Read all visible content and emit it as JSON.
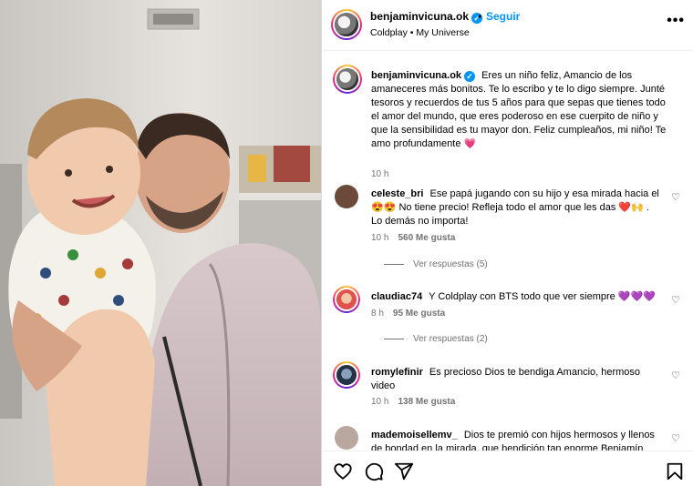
{
  "post": {
    "username": "benjaminvicuna.ok",
    "verified_icon": "verified-badge-icon",
    "follow_label": "Seguir",
    "separator": "•",
    "audio": "Coldplay • My Universe",
    "more_icon": "more-options-icon"
  },
  "caption": {
    "username": "benjaminvicuna.ok",
    "text": "Eres un niño feliz, Amancio de los amaneceres más bonitos. Te lo escribo y te lo digo siempre. Junté tesoros y recuerdos de tus 5 años para que sepas que tienes todo el amor del mundo, que eres poderoso en ese cuerpito de niño y que la sensibilidad es tu mayor don. Feliz cumpleaños, mi niño! Te amo profundamente 💗",
    "time": "10 h"
  },
  "comments": [
    {
      "username": "celeste_bri",
      "text": "Ese papá jugando con su hijo y esa mirada hacia el 😍😍 No tiene precio! Refleja todo el amor que les das ❤️🙌 . Lo demás no importa!",
      "time": "10 h",
      "likes": "560 Me gusta",
      "replies": "Ver respuestas (5)"
    },
    {
      "username": "claudiac74",
      "text": "Y Coldplay con BTS todo que ver siempre 💜💜💜",
      "time": "8 h",
      "likes": "95 Me gusta",
      "replies": "Ver respuestas (2)"
    },
    {
      "username": "romylefinir",
      "text": "Es precioso Dios te bendiga Amancio, hermoso video",
      "time": "10 h",
      "likes": "138 Me gusta"
    },
    {
      "username": "mademoisellemv_",
      "text": "Dios te premió con hijos hermosos y llenos de bondad en la mirada, que bendición tan enorme Benjamín"
    }
  ],
  "actions": {
    "like_icon": "heart-icon",
    "comment_icon": "comment-icon",
    "share_icon": "share-icon",
    "save_icon": "bookmark-icon"
  },
  "colors": {
    "accent": "#0095f6",
    "muted": "#737373",
    "border": "#dbdbdb"
  }
}
